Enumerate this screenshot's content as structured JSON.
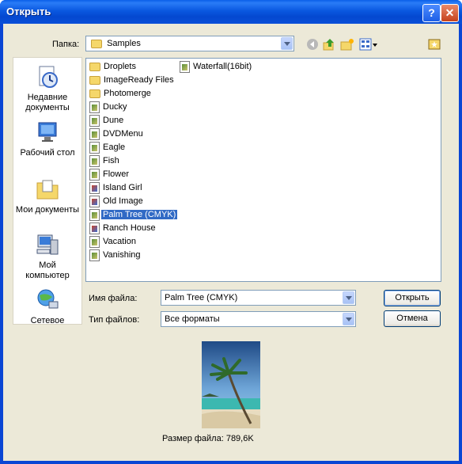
{
  "window": {
    "title": "Открыть"
  },
  "folder": {
    "label": "Папка:",
    "value": "Samples"
  },
  "places": [
    {
      "label1": "Недавние",
      "label2": "документы",
      "icon": "recent-documents-icon"
    },
    {
      "label1": "Рабочий стол",
      "label2": "",
      "icon": "desktop-icon"
    },
    {
      "label1": "Мои документы",
      "label2": "",
      "icon": "my-documents-icon"
    },
    {
      "label1": "Мой",
      "label2": "компьютер",
      "icon": "my-computer-icon"
    },
    {
      "label1": "Сетевое",
      "label2": "",
      "icon": "network-icon"
    }
  ],
  "files": [
    {
      "name": "Droplets",
      "type": "folder"
    },
    {
      "name": "ImageReady Files",
      "type": "folder"
    },
    {
      "name": "Photomerge",
      "type": "folder"
    },
    {
      "name": "Ducky",
      "type": "psd"
    },
    {
      "name": "Dune",
      "type": "psd"
    },
    {
      "name": "DVDMenu",
      "type": "psd"
    },
    {
      "name": "Eagle",
      "type": "psd"
    },
    {
      "name": "Fish",
      "type": "psd"
    },
    {
      "name": "Flower",
      "type": "psd"
    },
    {
      "name": "Island Girl",
      "type": "img"
    },
    {
      "name": "Old Image",
      "type": "img"
    },
    {
      "name": "Palm Tree (CMYK)",
      "type": "psd",
      "selected": true
    },
    {
      "name": "Ranch House",
      "type": "img"
    },
    {
      "name": "Vacation",
      "type": "psd"
    },
    {
      "name": "Vanishing",
      "type": "psd"
    },
    {
      "name": "Waterfall(16bit)",
      "type": "psd"
    }
  ],
  "filename": {
    "label": "Имя файла:",
    "value": "Palm Tree (CMYK)"
  },
  "filetype": {
    "label": "Тип файлов:",
    "value": "Все форматы"
  },
  "buttons": {
    "open": "Открыть",
    "cancel": "Отмена"
  },
  "preview": {
    "size_text": "Размер файла: 789,6K"
  },
  "colors": {
    "titlebar": "#0a58e0",
    "selection": "#316ac5",
    "dialog_bg": "#ece9d8"
  }
}
